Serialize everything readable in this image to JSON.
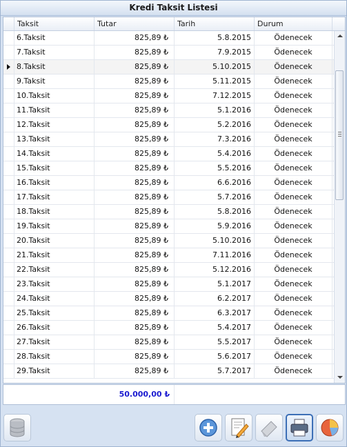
{
  "window": {
    "title": "Kredi Taksit Listesi"
  },
  "grid": {
    "columns": [
      "Taksit",
      "Tutar",
      "Tarih",
      "Durum"
    ],
    "selected_row_index": 2,
    "rows": [
      {
        "taksit": "6.Taksit",
        "tutar": "825,89 ₺",
        "tarih": "5.8.2015",
        "durum": "Ödenecek"
      },
      {
        "taksit": "7.Taksit",
        "tutar": "825,89 ₺",
        "tarih": "7.9.2015",
        "durum": "Ödenecek"
      },
      {
        "taksit": "8.Taksit",
        "tutar": "825,89 ₺",
        "tarih": "5.10.2015",
        "durum": "Ödenecek"
      },
      {
        "taksit": "9.Taksit",
        "tutar": "825,89 ₺",
        "tarih": "5.11.2015",
        "durum": "Ödenecek"
      },
      {
        "taksit": "10.Taksit",
        "tutar": "825,89 ₺",
        "tarih": "7.12.2015",
        "durum": "Ödenecek"
      },
      {
        "taksit": "11.Taksit",
        "tutar": "825,89 ₺",
        "tarih": "5.1.2016",
        "durum": "Ödenecek"
      },
      {
        "taksit": "12.Taksit",
        "tutar": "825,89 ₺",
        "tarih": "5.2.2016",
        "durum": "Ödenecek"
      },
      {
        "taksit": "13.Taksit",
        "tutar": "825,89 ₺",
        "tarih": "7.3.2016",
        "durum": "Ödenecek"
      },
      {
        "taksit": "14.Taksit",
        "tutar": "825,89 ₺",
        "tarih": "5.4.2016",
        "durum": "Ödenecek"
      },
      {
        "taksit": "15.Taksit",
        "tutar": "825,89 ₺",
        "tarih": "5.5.2016",
        "durum": "Ödenecek"
      },
      {
        "taksit": "16.Taksit",
        "tutar": "825,89 ₺",
        "tarih": "6.6.2016",
        "durum": "Ödenecek"
      },
      {
        "taksit": "17.Taksit",
        "tutar": "825,89 ₺",
        "tarih": "5.7.2016",
        "durum": "Ödenecek"
      },
      {
        "taksit": "18.Taksit",
        "tutar": "825,89 ₺",
        "tarih": "5.8.2016",
        "durum": "Ödenecek"
      },
      {
        "taksit": "19.Taksit",
        "tutar": "825,89 ₺",
        "tarih": "5.9.2016",
        "durum": "Ödenecek"
      },
      {
        "taksit": "20.Taksit",
        "tutar": "825,89 ₺",
        "tarih": "5.10.2016",
        "durum": "Ödenecek"
      },
      {
        "taksit": "21.Taksit",
        "tutar": "825,89 ₺",
        "tarih": "7.11.2016",
        "durum": "Ödenecek"
      },
      {
        "taksit": "22.Taksit",
        "tutar": "825,89 ₺",
        "tarih": "5.12.2016",
        "durum": "Ödenecek"
      },
      {
        "taksit": "23.Taksit",
        "tutar": "825,89 ₺",
        "tarih": "5.1.2017",
        "durum": "Ödenecek"
      },
      {
        "taksit": "24.Taksit",
        "tutar": "825,89 ₺",
        "tarih": "6.2.2017",
        "durum": "Ödenecek"
      },
      {
        "taksit": "25.Taksit",
        "tutar": "825,89 ₺",
        "tarih": "6.3.2017",
        "durum": "Ödenecek"
      },
      {
        "taksit": "26.Taksit",
        "tutar": "825,89 ₺",
        "tarih": "5.4.2017",
        "durum": "Ödenecek"
      },
      {
        "taksit": "27.Taksit",
        "tutar": "825,89 ₺",
        "tarih": "5.5.2017",
        "durum": "Ödenecek"
      },
      {
        "taksit": "28.Taksit",
        "tutar": "825,89 ₺",
        "tarih": "5.6.2017",
        "durum": "Ödenecek"
      },
      {
        "taksit": "29.Taksit",
        "tutar": "825,89 ₺",
        "tarih": "5.7.2017",
        "durum": "Ödenecek"
      }
    ]
  },
  "footer": {
    "total": "50.000,00 ₺"
  },
  "toolbar": {
    "left": [
      {
        "name": "database-button",
        "icon": "database-icon"
      }
    ],
    "right": [
      {
        "name": "add-button",
        "icon": "plus-icon",
        "active": false
      },
      {
        "name": "edit-button",
        "icon": "edit-icon",
        "active": false
      },
      {
        "name": "erase-button",
        "icon": "eraser-icon",
        "active": false
      },
      {
        "name": "print-button",
        "icon": "printer-icon",
        "active": true
      },
      {
        "name": "report-button",
        "icon": "pie-chart-icon",
        "active": false
      }
    ]
  },
  "colors": {
    "total_text": "#1a1ad0",
    "window_bg": "#d6e2f2",
    "active_border": "#3c6fb6"
  }
}
